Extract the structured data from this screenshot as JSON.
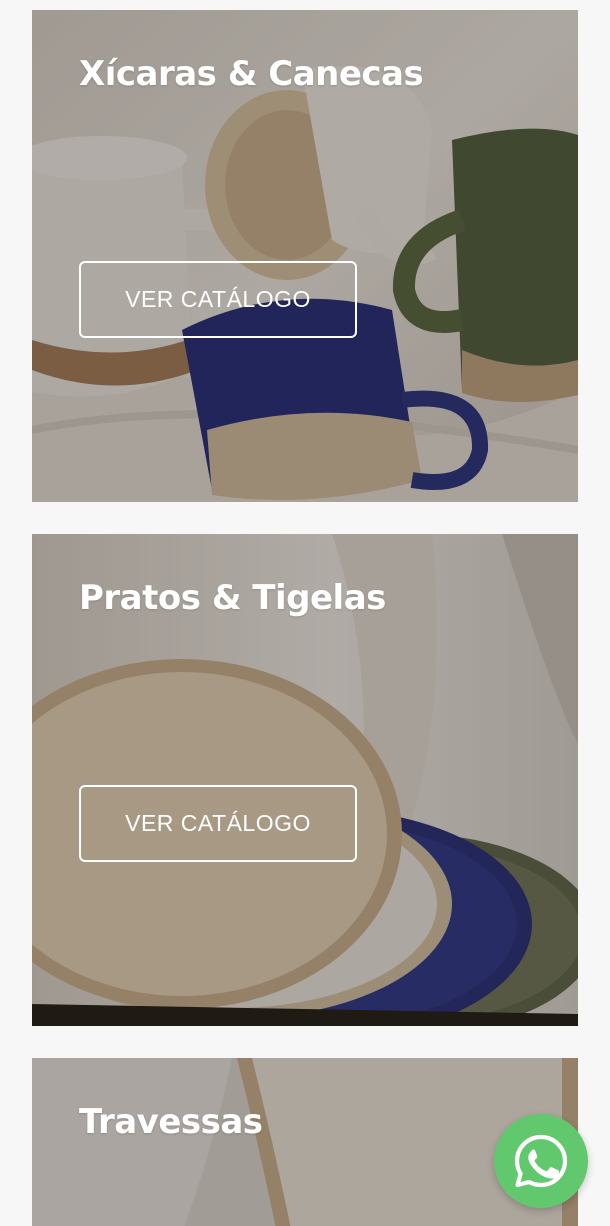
{
  "categories": [
    {
      "title": "Xícaras & Canecas",
      "button_label": "VER CATÁLOGO"
    },
    {
      "title": "Pratos & Tigelas",
      "button_label": "VER CATÁLOGO"
    },
    {
      "title": "Travessas"
    }
  ],
  "floating_action": {
    "icon": "whatsapp-icon",
    "color": "#62c86d"
  },
  "colors": {
    "page_background": "#f7f7f7",
    "cobalt_glaze": "#1e2a78",
    "olive_glaze": "#4a5a3a",
    "cream_ceramic": "#e7dcc8"
  }
}
